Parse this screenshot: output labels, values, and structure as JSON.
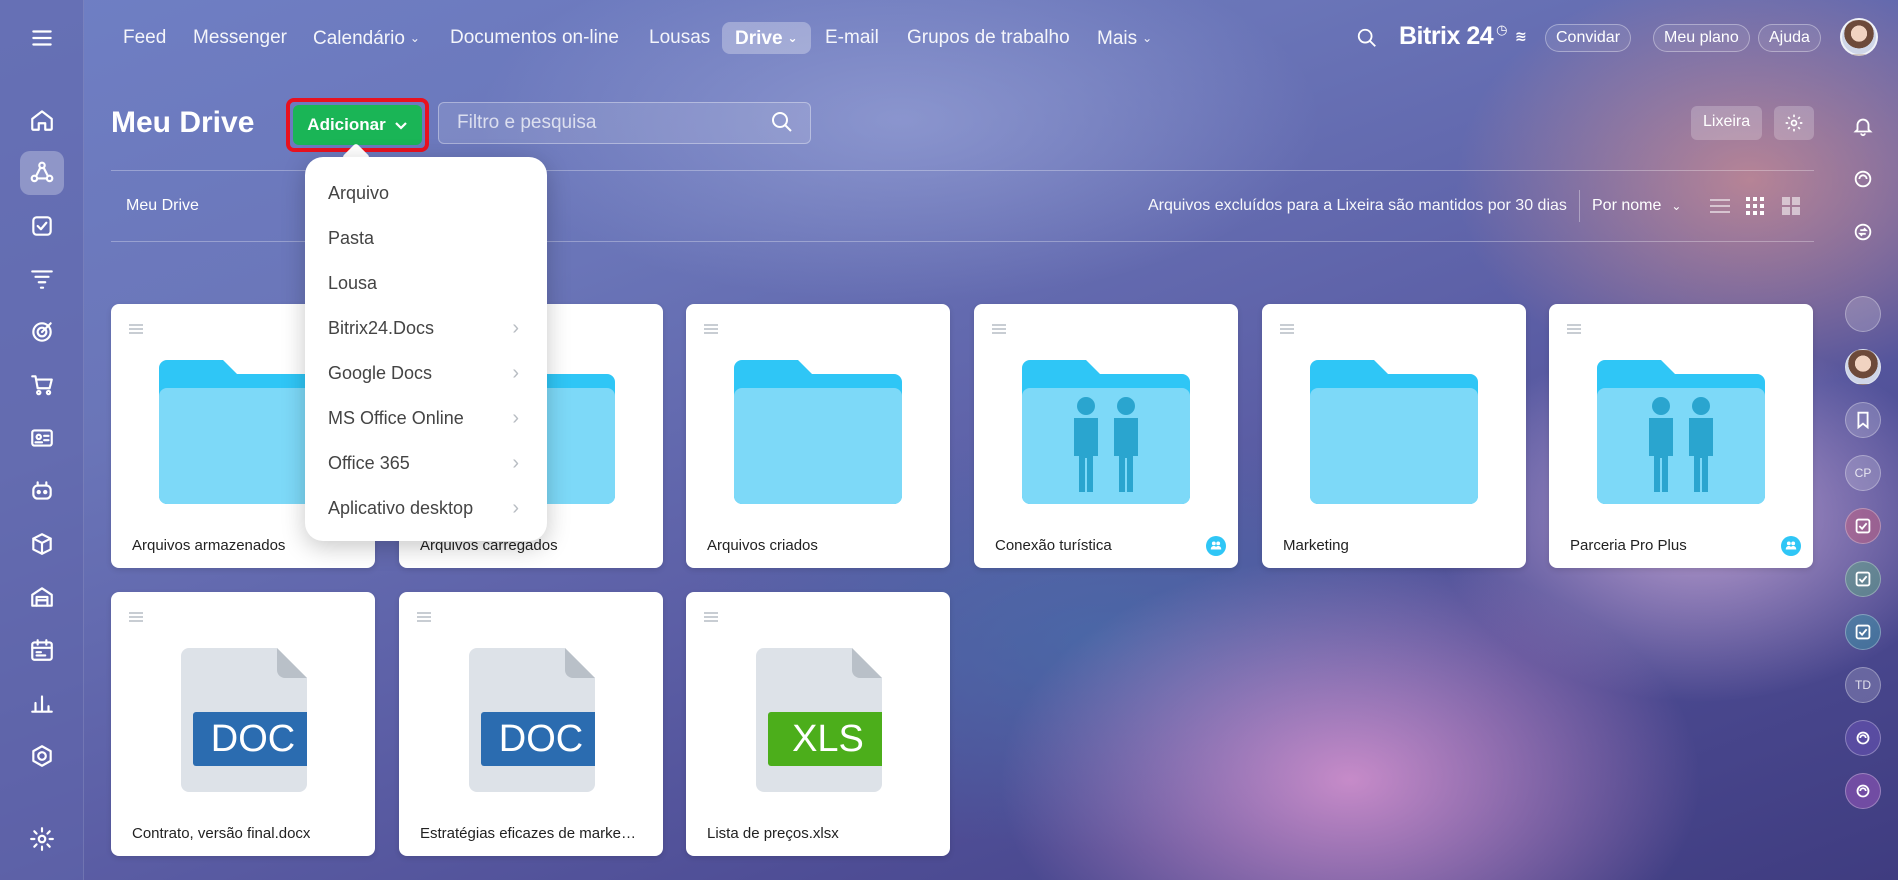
{
  "nav": {
    "items": [
      {
        "label": "Feed"
      },
      {
        "label": "Messenger"
      },
      {
        "label": "Calendário"
      },
      {
        "label": "Documentos on-line"
      },
      {
        "label": "Lousas"
      },
      {
        "label": "Drive"
      },
      {
        "label": "E-mail"
      },
      {
        "label": "Grupos de trabalho"
      },
      {
        "label": "Mais"
      }
    ],
    "brand": "Bitrix 24",
    "invite": "Convidar",
    "plan": "Meu plano",
    "help": "Ajuda"
  },
  "header": {
    "title": "Meu Drive",
    "add_label": "Adicionar",
    "search_placeholder": "Filtro e pesquisa",
    "trash_label": "Lixeira"
  },
  "toolbar": {
    "breadcrumb": "Meu Drive",
    "retention_note": "Arquivos excluídos para a Lixeira são mantidos por 30 dias",
    "sort_label": "Por nome"
  },
  "add_menu": {
    "items": [
      {
        "label": "Arquivo",
        "submenu": false
      },
      {
        "label": "Pasta",
        "submenu": false
      },
      {
        "label": "Lousa",
        "submenu": false
      },
      {
        "label": "Bitrix24.Docs",
        "submenu": true
      },
      {
        "label": "Google Docs",
        "submenu": true
      },
      {
        "label": "MS Office Online",
        "submenu": true
      },
      {
        "label": "Office 365",
        "submenu": true
      },
      {
        "label": "Aplicativo desktop",
        "submenu": true
      }
    ]
  },
  "files": [
    {
      "name": "Arquivos armazenados",
      "type": "folder",
      "shared": false
    },
    {
      "name": "Arquivos carregados",
      "type": "folder",
      "shared": false
    },
    {
      "name": "Arquivos criados",
      "type": "folder",
      "shared": false
    },
    {
      "name": "Conexão turística",
      "type": "group-folder",
      "shared": true
    },
    {
      "name": "Marketing",
      "type": "folder",
      "shared": false
    },
    {
      "name": "Parceria Pro Plus",
      "type": "group-folder",
      "shared": true
    },
    {
      "name": "Contrato, versão final.docx",
      "type": "doc",
      "badge": "DOC",
      "badge_color": "#2b6cb0"
    },
    {
      "name": "Estratégias eficazes de marketing.docx",
      "type": "doc",
      "badge": "DOC",
      "badge_color": "#2b6cb0"
    },
    {
      "name": "Lista de preços.xlsx",
      "type": "xls",
      "badge": "XLS",
      "badge_color": "#4cae1b"
    }
  ],
  "rightbar": {
    "initials": [
      "CP",
      "TD"
    ]
  },
  "colors": {
    "add_button": "#1ab556",
    "highlight_frame": "#e8111f",
    "folder": "#7dd9f8",
    "folder_tab": "#2fc6f6"
  }
}
